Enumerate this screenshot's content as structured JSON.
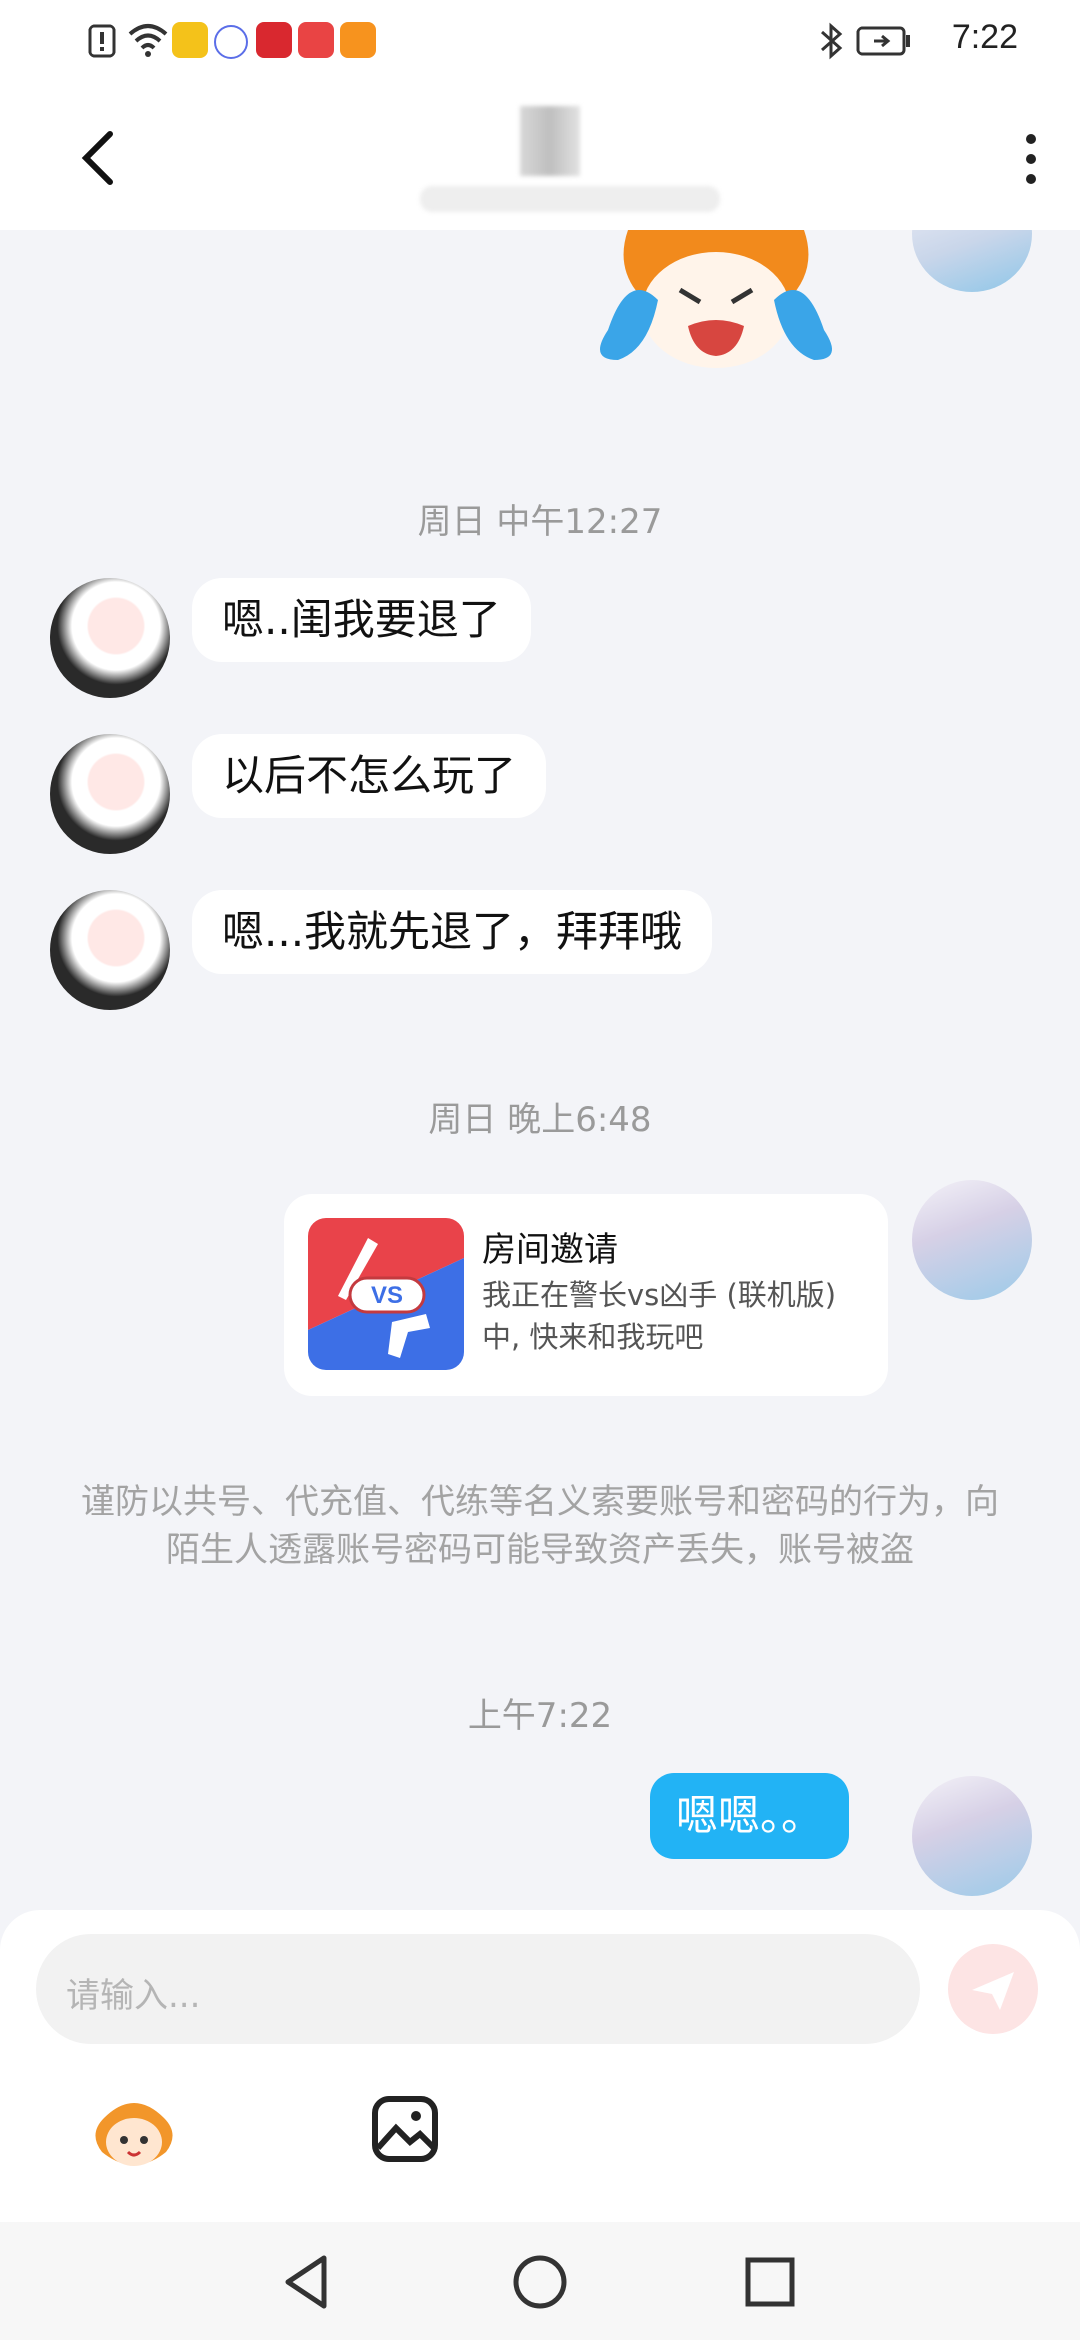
{
  "status_bar": {
    "time": "7:22",
    "left_icons": [
      "alert-icon",
      "wifi-icon",
      "app-yellow-icon",
      "music-icon",
      "taobao-icon",
      "huawei-mall-icon",
      "video-icon"
    ],
    "right_icons": [
      "bluetooth-icon",
      "battery-icon"
    ]
  },
  "header": {
    "title": "",
    "back_icon": "back-chevron-icon",
    "menu_icon": "more-vert-icon"
  },
  "messages": [
    {
      "type": "timestamp",
      "text": "周日 中午12:27"
    },
    {
      "type": "received",
      "text": "嗯..闺我要退了"
    },
    {
      "type": "received",
      "text": "以后不怎么玩了"
    },
    {
      "type": "received",
      "text": "嗯...我就先退了，拜拜哦"
    },
    {
      "type": "timestamp",
      "text": "周日 晚上6:48"
    },
    {
      "type": "sent_card",
      "title": "房间邀请",
      "description": "我正在警长vs凶手 (联机版)中, 快来和我玩吧",
      "icon_text": "VS"
    },
    {
      "type": "system_notice",
      "text": "谨防以共号、代充值、代练等名义索要账号和密码的行为，向陌生人透露账号密码可能导致资产丢失，账号被盗"
    },
    {
      "type": "timestamp",
      "text": "上午7:22"
    },
    {
      "type": "sent",
      "text": "嗯嗯。。"
    }
  ],
  "input": {
    "placeholder": "请输入..."
  },
  "colors": {
    "sent_bubble": "#22b3f5",
    "background": "#f3f4f8",
    "send_button": "#fde4e4"
  }
}
